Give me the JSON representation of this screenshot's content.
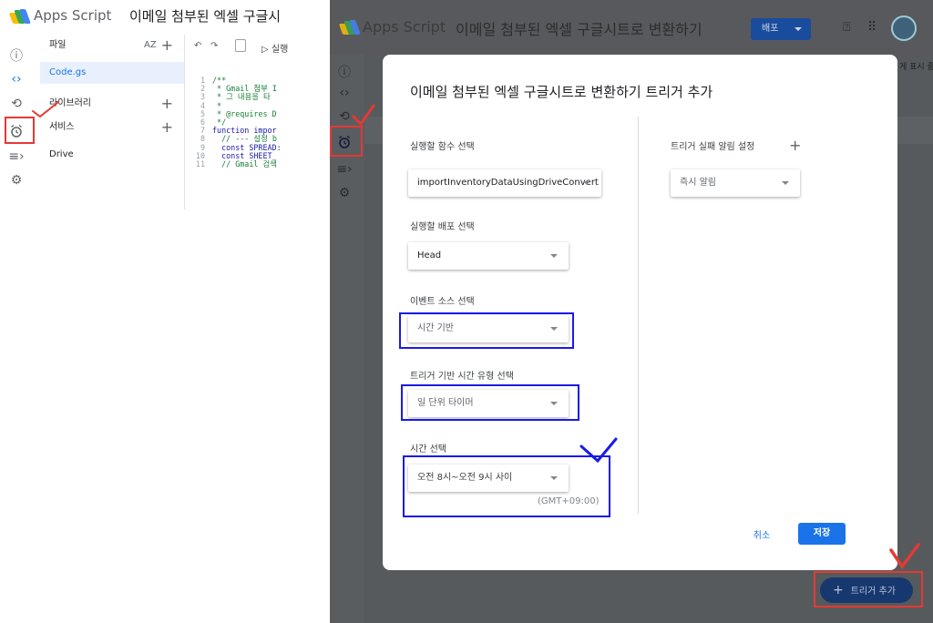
{
  "left": {
    "brand": "Apps Script",
    "project_title": "이메일 첨부된 엑셀 구글시",
    "panel": {
      "files_label": "파일",
      "sort_label": "AZ",
      "file_item": "Code.gs",
      "libraries_label": "라이브러리",
      "services_label": "서비스",
      "drive_label": "Drive"
    },
    "toolbar": {
      "undo": "↶",
      "redo": "↷",
      "run_label": "▷ 실행"
    },
    "code_lines": [
      {
        "n": "1",
        "t": "/**"
      },
      {
        "n": "2",
        "t": " * Gmail 첨부 I"
      },
      {
        "n": "3",
        "t": " * 그 내용을 타"
      },
      {
        "n": "4",
        "t": " *"
      },
      {
        "n": "5",
        "t": " * @requires D"
      },
      {
        "n": "6",
        "t": " */"
      },
      {
        "n": "7",
        "t": "function impor"
      },
      {
        "n": "8",
        "t": "  // --- 설정 b"
      },
      {
        "n": "9",
        "t": "  const SPREAD:"
      },
      {
        "n": "10",
        "t": "  const SHEET_"
      },
      {
        "n": "11",
        "t": "  // Gmail 검색"
      }
    ]
  },
  "right": {
    "brand": "Apps Script",
    "project_title": "이메일 첨부된 엑셀 구글시트로 변환하기",
    "deploy_label": "배포",
    "publishing_text": "게 표시 중",
    "dialog": {
      "title": "이메일 첨부된 엑셀 구글시트로 변환하기 트리거 추가",
      "function_label": "실행할 함수 선택",
      "function_value": "importInventoryDataUsingDriveConvert",
      "deployment_label": "실행할 배포 선택",
      "deployment_value": "Head",
      "event_source_label": "이벤트 소스 선택",
      "event_source_value": "시간 기반",
      "timer_type_label": "트리거 기반 시간 유형 선택",
      "timer_type_value": "일 단위 타이머",
      "time_label": "시간 선택",
      "time_value": "오전 8시~오전 9시 사이",
      "timezone": "(GMT+09:00)",
      "failure_label": "트리거 실패 알림 설정",
      "failure_value": "즉시 알림",
      "cancel_label": "취소",
      "save_label": "저장"
    },
    "fab_label": "트리거 추가"
  },
  "colors": {
    "accent_blue": "#1a73e8",
    "annotation_red": "#e53935",
    "annotation_blue": "#1a1ae6"
  }
}
